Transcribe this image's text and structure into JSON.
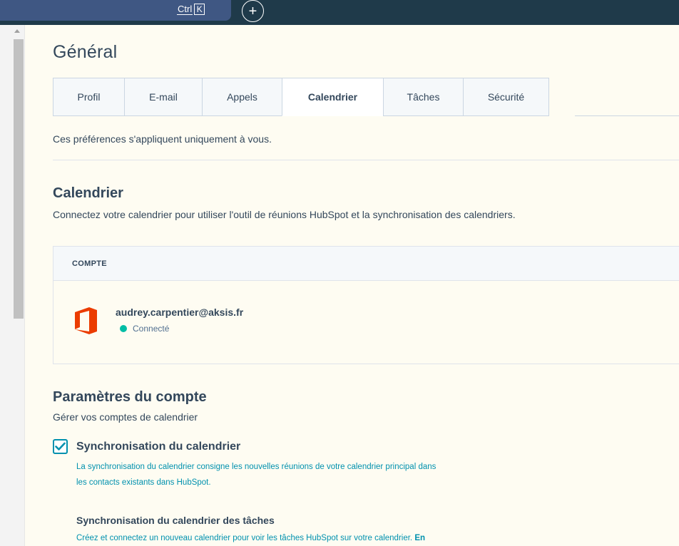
{
  "topbar": {
    "shortcut_ctrl": "Ctrl",
    "shortcut_key": "K",
    "new_button_label": "+"
  },
  "page": {
    "title": "Général"
  },
  "tabs": [
    {
      "label": "Profil",
      "active": false
    },
    {
      "label": "E-mail",
      "active": false
    },
    {
      "label": "Appels",
      "active": false
    },
    {
      "label": "Calendrier",
      "active": true
    },
    {
      "label": "Tâches",
      "active": false
    },
    {
      "label": "Sécurité",
      "active": false
    }
  ],
  "notice": "Ces préférences s'appliquent uniquement à vous.",
  "calendar_section": {
    "title": "Calendrier",
    "description": "Connectez votre calendrier pour utiliser l'outil de réunions HubSpot et la synchronisation des calendriers."
  },
  "account_table": {
    "header": "COMPTE",
    "account_email": "audrey.carpentier@aksis.fr",
    "account_status": "Connecté",
    "status_color": "#00bda5",
    "provider_icon": "office-icon"
  },
  "account_settings": {
    "title": "Paramètres du compte",
    "description": "Gérer vos comptes de calendrier",
    "sync_checkbox": {
      "checked": true,
      "label": "Synchronisation du calendrier",
      "help_line1": "La synchronisation du calendrier consigne les nouvelles réunions de votre calendrier principal dans",
      "help_line2": "les contacts existants dans HubSpot."
    },
    "task_sync": {
      "title": "Synchronisation du calendrier des tâches",
      "help": "Créez et connectez un nouveau calendrier pour voir les tâches HubSpot sur votre calendrier.",
      "link": "En"
    }
  },
  "colors": {
    "accent": "#0091ae",
    "topbar": "#1f3a4a",
    "office_orange": "#eb3c00"
  }
}
